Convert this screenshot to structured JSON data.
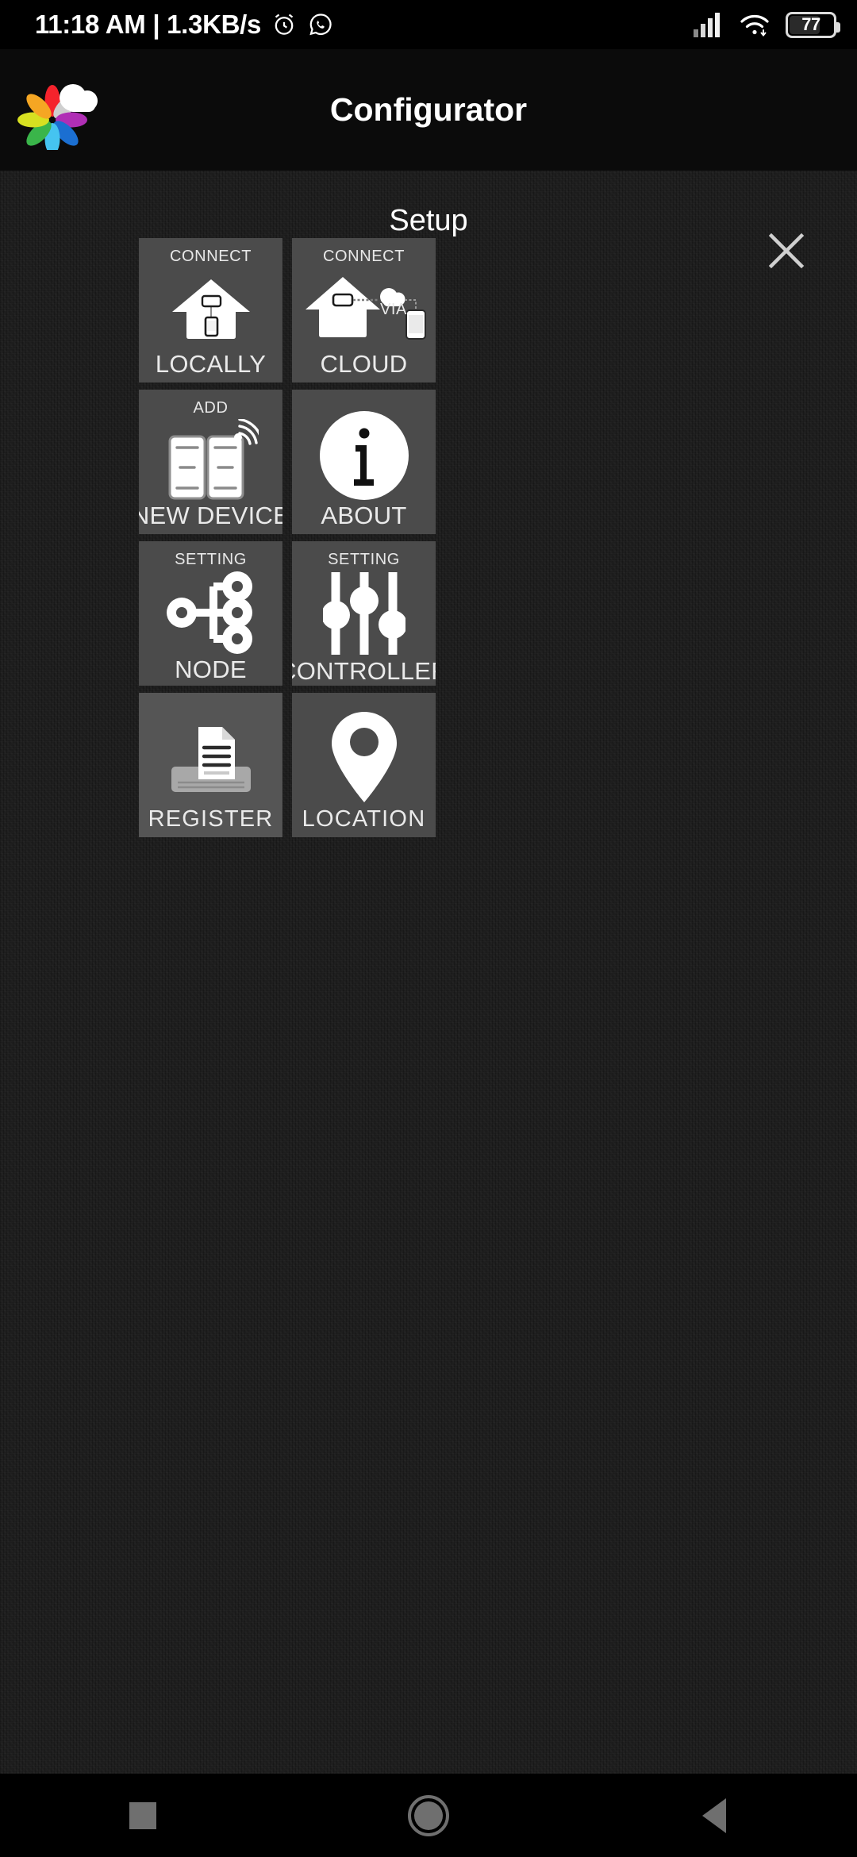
{
  "statusbar": {
    "clock": "11:18 AM | 1.3KB/s",
    "alarm_icon": "alarm-clock-icon",
    "whatsapp_icon": "whatsapp-icon",
    "signal_icon": "cellular-signal-icon",
    "wifi_icon": "wifi-icon",
    "battery_level": "77"
  },
  "appbar": {
    "logo": "flower-cloud-logo",
    "title": "Configurator"
  },
  "page": {
    "title": "Setup",
    "close_label": "close-icon"
  },
  "tiles": [
    {
      "top": "CONNECT",
      "bottom": "LOCALLY",
      "icon": "house-local-connect-icon",
      "via": "",
      "highlight": false
    },
    {
      "top": "CONNECT",
      "bottom": "CLOUD",
      "icon": "house-cloud-connect-icon",
      "via": "VIA",
      "highlight": false
    },
    {
      "top": "ADD",
      "bottom": "NEW DEVICE",
      "icon": "wifi-switch-panel-icon",
      "via": "",
      "highlight": false
    },
    {
      "top": "",
      "bottom": "ABOUT",
      "icon": "info-circle-icon",
      "via": "",
      "highlight": false
    },
    {
      "top": "SETTING",
      "bottom": "NODE",
      "icon": "node-hierarchy-icon",
      "via": "",
      "highlight": false
    },
    {
      "top": "SETTING",
      "bottom": "CONTROLLER",
      "icon": "sliders-icon",
      "via": "",
      "highlight": false
    },
    {
      "top": "",
      "bottom": "REGISTER",
      "icon": "document-tray-icon",
      "via": "",
      "highlight": true
    },
    {
      "top": "",
      "bottom": "LOCATION",
      "icon": "map-pin-icon",
      "via": "",
      "highlight": false
    }
  ],
  "navbar": {
    "recents_label": "recents-button",
    "home_label": "home-button",
    "back_label": "back-button"
  },
  "colors": {
    "tile": "#4b4b4b",
    "tile_highlight": "#555555",
    "page_bg": "#1d1d1d",
    "bar_bg": "#0b0b0b",
    "text": "#eaeaea"
  }
}
